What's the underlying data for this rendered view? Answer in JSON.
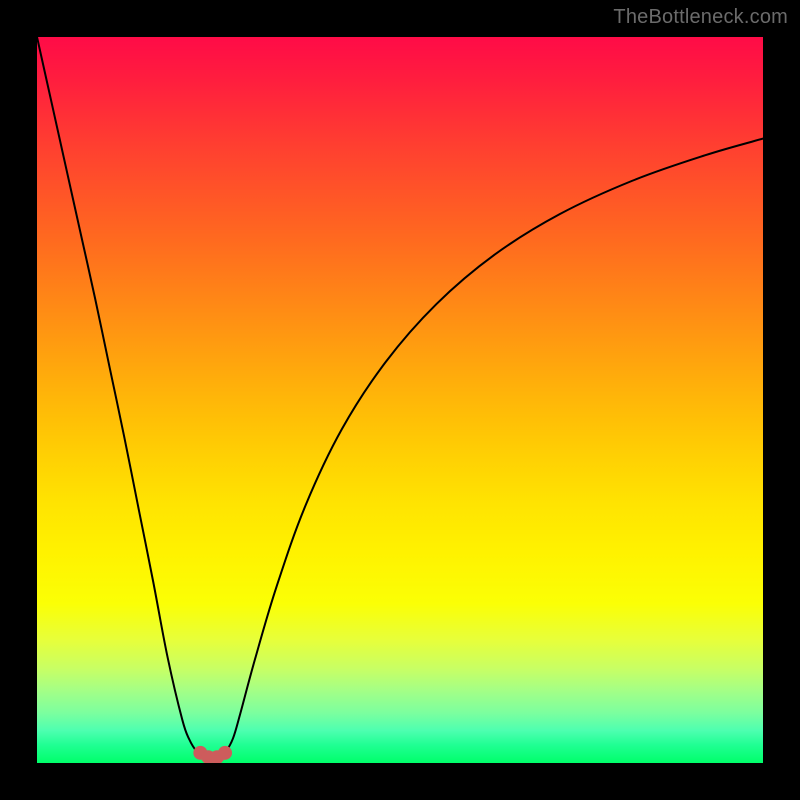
{
  "watermark": "TheBottleneck.com",
  "chart_data": {
    "type": "line",
    "title": "",
    "xlabel": "",
    "ylabel": "",
    "x_range": [
      0,
      100
    ],
    "y_range": [
      0,
      100
    ],
    "grid": false,
    "legend": false,
    "background": {
      "type": "vertical-gradient",
      "stops": [
        {
          "pos": 0,
          "color": "#ff0b47"
        },
        {
          "pos": 28,
          "color": "#ff6a1f"
        },
        {
          "pos": 58,
          "color": "#ffd103"
        },
        {
          "pos": 78,
          "color": "#fbff05"
        },
        {
          "pos": 100,
          "color": "#00ff6a"
        }
      ]
    },
    "series": [
      {
        "name": "bottleneck-curve",
        "x": [
          0,
          2,
          4,
          6,
          8,
          10,
          12,
          14,
          16,
          18,
          20,
          21,
          22,
          23,
          24,
          25,
          26,
          27,
          28,
          30,
          33,
          37,
          42,
          48,
          55,
          63,
          72,
          82,
          92,
          100
        ],
        "y": [
          100,
          91,
          82,
          73,
          64,
          54.5,
          45,
          35,
          25,
          14.5,
          6,
          3.2,
          1.6,
          0.9,
          0.7,
          0.9,
          1.6,
          3.4,
          6.8,
          14.2,
          24.3,
          35.5,
          46.0,
          55.2,
          63.2,
          70.0,
          75.6,
          80.2,
          83.7,
          86.0
        ]
      }
    ],
    "markers": [
      {
        "name": "min-cluster-left",
        "x": 22.5,
        "y": 1.4,
        "color": "#cd5c5c",
        "size": 14
      },
      {
        "name": "min-cluster-mid-l",
        "x": 23.6,
        "y": 0.8,
        "color": "#cd5c5c",
        "size": 14
      },
      {
        "name": "min-cluster-mid-r",
        "x": 24.8,
        "y": 0.8,
        "color": "#cd5c5c",
        "size": 14
      },
      {
        "name": "min-cluster-right",
        "x": 25.9,
        "y": 1.4,
        "color": "#cd5c5c",
        "size": 14
      }
    ],
    "minimum": {
      "x": 24.2,
      "y": 0.7
    }
  }
}
